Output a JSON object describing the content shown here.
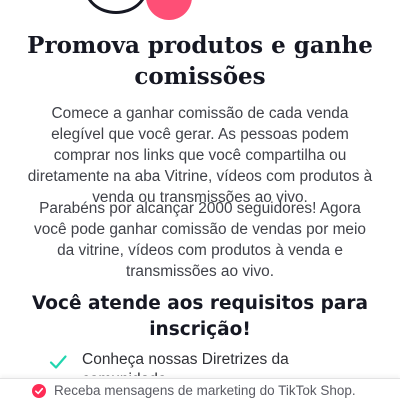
{
  "header": {
    "title": "Promova produtos e ganhe comissões"
  },
  "intro": {
    "paragraph1": "Comece a ganhar comissão de cada venda elegível que você gerar. As pessoas podem comprar nos links que você compartilha ou diretamente na aba Vitrine, vídeos com produtos à venda ou transmissões ao vivo.",
    "paragraph2": "Parabéns por alcançar 2000 seguidores! Agora você pode ganhar comissão de vendas por meio da vitrine, vídeos com produtos à venda e transmissões ao vivo."
  },
  "requirements": {
    "title": "Você atende aos requisitos para inscrição!",
    "items": [
      {
        "label": "Conheça nossas Diretrizes da comunidade",
        "icon": "check-icon",
        "status": "met"
      }
    ]
  },
  "footer": {
    "marketing_opt_in_label": "Receba mensagens de marketing do TikTok Shop.",
    "marketing_opt_in_checked": true
  },
  "colors": {
    "accent": "#fe2c55",
    "check": "#20d5ae",
    "text_primary": "#161823",
    "text_secondary": "#404249"
  }
}
